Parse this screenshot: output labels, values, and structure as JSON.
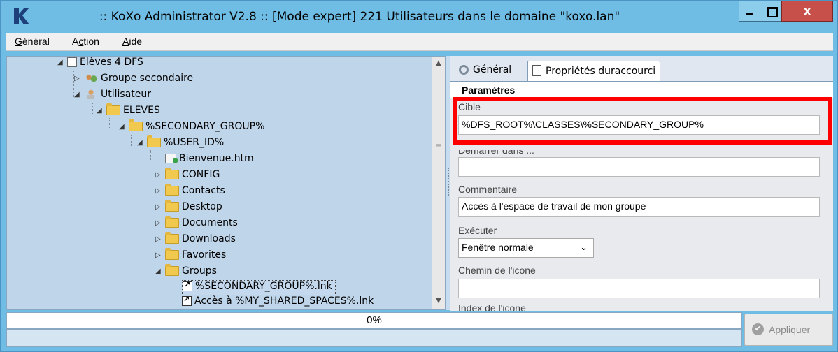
{
  "window": {
    "title": ":: KoXo Administrator V2.8 :: [Mode expert] 221 Utilisateurs dans le domaine \"koxo.lan\"",
    "close_label": "x"
  },
  "menu": [
    {
      "label_prefix": "",
      "underline": "G",
      "label_rest": "énéral"
    },
    {
      "label_prefix": "A",
      "underline": "c",
      "label_rest": "tion"
    },
    {
      "label_prefix": "",
      "underline": "A",
      "label_rest": "ide"
    }
  ],
  "tree": {
    "nodes": [
      {
        "label": "Elèves 4 DFS",
        "icon": "document-icon",
        "expander": "◢"
      },
      {
        "label": "Groupe secondaire",
        "icon": "group-icon",
        "expander": "▷"
      },
      {
        "label": "Utilisateur",
        "icon": "user-icon",
        "expander": "◢"
      },
      {
        "label": "ELEVES",
        "icon": "folder-icon",
        "expander": "◢"
      },
      {
        "label": "%SECONDARY_GROUP%",
        "icon": "folder-icon",
        "expander": "◢"
      },
      {
        "label": "%USER_ID%",
        "icon": "folder-icon",
        "expander": "◢"
      },
      {
        "label": "Bienvenue.htm",
        "icon": "htm-file-icon",
        "expander": ""
      },
      {
        "label": "CONFIG",
        "icon": "folder-icon",
        "expander": "▷"
      },
      {
        "label": "Contacts",
        "icon": "folder-icon",
        "expander": "▷"
      },
      {
        "label": "Desktop",
        "icon": "folder-icon",
        "expander": "▷"
      },
      {
        "label": "Documents",
        "icon": "folder-icon",
        "expander": "▷"
      },
      {
        "label": "Downloads",
        "icon": "folder-icon",
        "expander": "▷"
      },
      {
        "label": "Favorites",
        "icon": "folder-icon",
        "expander": "▷"
      },
      {
        "label": "Groups",
        "icon": "folder-icon",
        "expander": "◢"
      },
      {
        "label": "%SECONDARY_GROUP%.lnk",
        "icon": "shortcut-icon",
        "expander": ""
      },
      {
        "label": "Accès à %MY_SHARED_SPACES%.lnk",
        "icon": "shortcut-icon",
        "expander": ""
      }
    ]
  },
  "tabs": [
    {
      "label": "Général",
      "icon": "gear-icon"
    },
    {
      "label": "Propriétés duraccourci",
      "icon": "page-icon"
    }
  ],
  "properties": {
    "section_title": "Paramètres",
    "cible_label": "Cible",
    "cible_value": "%DFS_ROOT%\\CLASSES\\%SECONDARY_GROUP%",
    "start_in_label": "Démarrer dans ...",
    "start_in_value": "",
    "comment_label": "Commentaire",
    "comment_value": "Accès à l'espace de travail de mon groupe",
    "run_label": "Exécuter",
    "run_value": "Fenêtre normale",
    "icon_path_label": "Chemin de l'icone",
    "icon_path_value": "",
    "icon_index_label": "Index de l'icone"
  },
  "status": {
    "progress_text": "0%",
    "progress": 0,
    "apply_label": "Appliquer"
  }
}
